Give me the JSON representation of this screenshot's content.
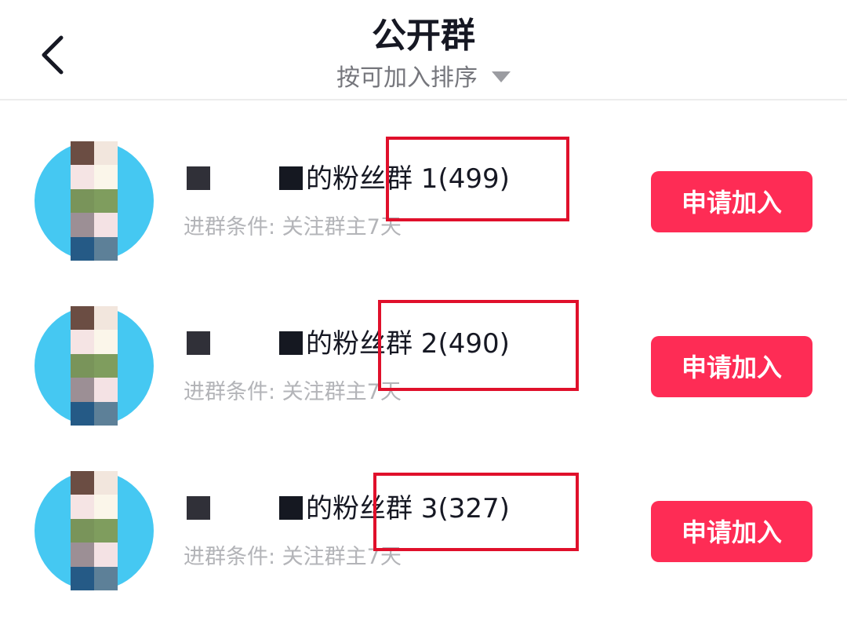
{
  "header": {
    "title": "公开群",
    "sort_label": "按可加入排序"
  },
  "groups": [
    {
      "name_suffix": "的粉丝群 1(499)",
      "condition": "进群条件: 关注群主7天",
      "join_label": "申请加入"
    },
    {
      "name_suffix": "的粉丝群 2(490)",
      "condition": "进群条件: 关注群主7天",
      "join_label": "申请加入"
    },
    {
      "name_suffix": "的粉丝群 3(327)",
      "condition": "进群条件: 关注群主7天",
      "join_label": "申请加入"
    }
  ],
  "colors": {
    "accent": "#fe2c55",
    "highlight_box": "#e0102b",
    "avatar_bg": "#45c8f2"
  }
}
